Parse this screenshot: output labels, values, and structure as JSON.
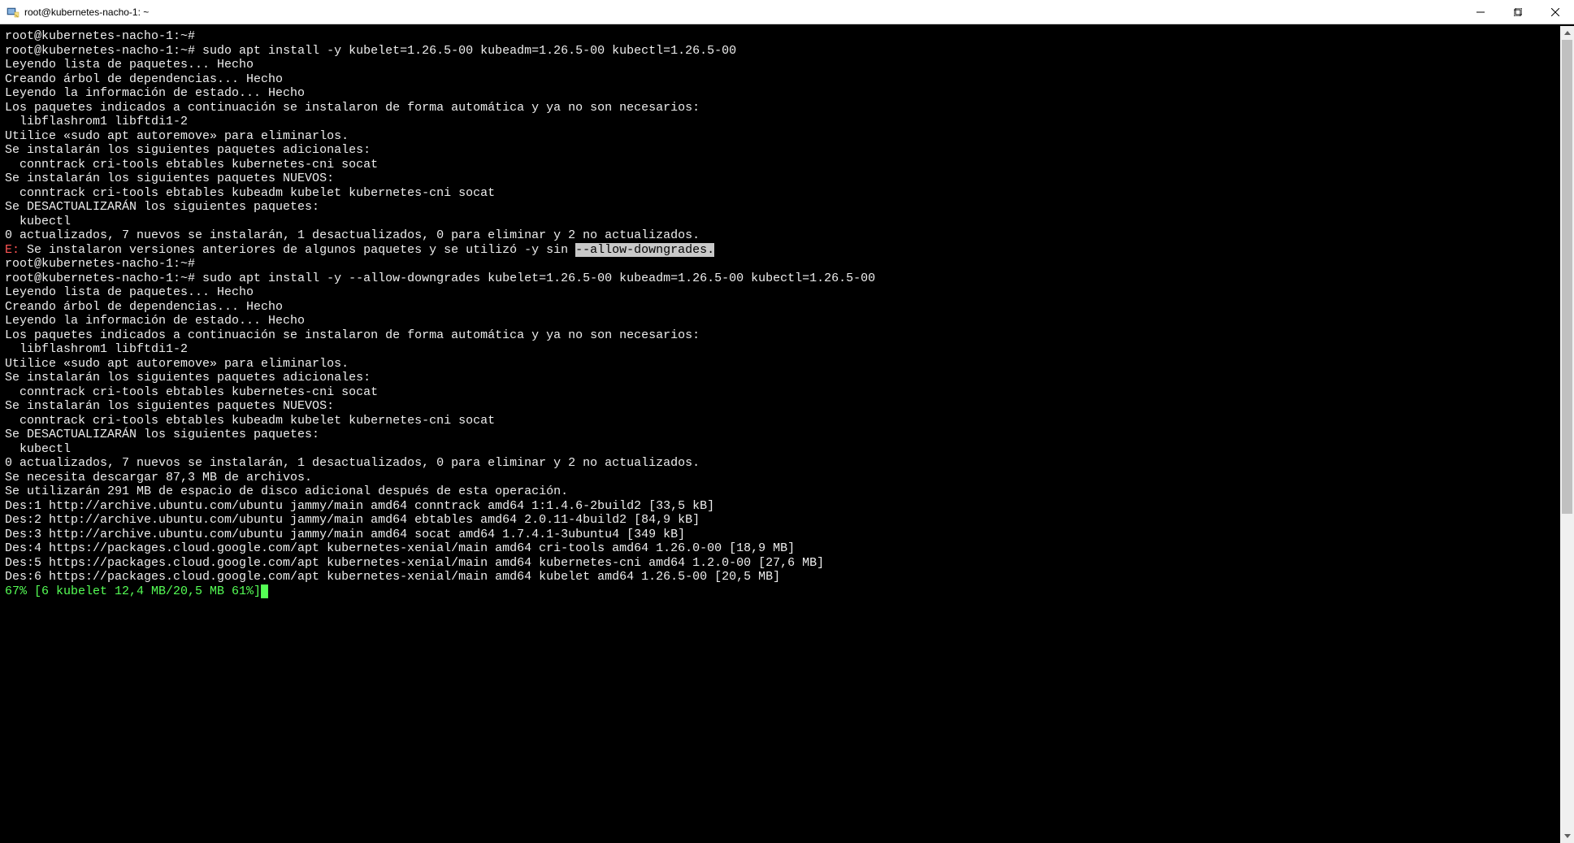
{
  "window": {
    "title": "root@kubernetes-nacho-1: ~"
  },
  "terminal": {
    "prompt1": "root@kubernetes-nacho-1:~#",
    "prompt1_cmd": "",
    "prompt2": "root@kubernetes-nacho-1:~#",
    "prompt2_cmd": " sudo apt install -y kubelet=1.26.5-00 kubeadm=1.26.5-00 kubectl=1.26.5-00",
    "b1_l1": "Leyendo lista de paquetes... Hecho",
    "b1_l2": "Creando árbol de dependencias... Hecho",
    "b1_l3": "Leyendo la información de estado... Hecho",
    "b1_l4": "Los paquetes indicados a continuación se instalaron de forma automática y ya no son necesarios:",
    "b1_l5": "  libflashrom1 libftdi1-2",
    "b1_l6": "Utilice «sudo apt autoremove» para eliminarlos.",
    "b1_l7": "Se instalarán los siguientes paquetes adicionales:",
    "b1_l8": "  conntrack cri-tools ebtables kubernetes-cni socat",
    "b1_l9": "Se instalarán los siguientes paquetes NUEVOS:",
    "b1_l10": "  conntrack cri-tools ebtables kubeadm kubelet kubernetes-cni socat",
    "b1_l11": "Se DESACTUALIZARÁN los siguientes paquetes:",
    "b1_l12": "  kubectl",
    "b1_l13": "0 actualizados, 7 nuevos se instalarán, 1 desactualizados, 0 para eliminar y 2 no actualizados.",
    "err_prefix": "E:",
    "err_text": " Se instalaron versiones anteriores de algunos paquetes y se utilizó -y sin ",
    "err_sel": "--allow-downgrades.",
    "prompt3": "root@kubernetes-nacho-1:~#",
    "prompt3_cmd": "",
    "prompt4": "root@kubernetes-nacho-1:~#",
    "prompt4_cmd": " sudo apt install -y --allow-downgrades kubelet=1.26.5-00 kubeadm=1.26.5-00 kubectl=1.26.5-00",
    "b2_l1": "Leyendo lista de paquetes... Hecho",
    "b2_l2": "Creando árbol de dependencias... Hecho",
    "b2_l3": "Leyendo la información de estado... Hecho",
    "b2_l4": "Los paquetes indicados a continuación se instalaron de forma automática y ya no son necesarios:",
    "b2_l5": "  libflashrom1 libftdi1-2",
    "b2_l6": "Utilice «sudo apt autoremove» para eliminarlos.",
    "b2_l7": "Se instalarán los siguientes paquetes adicionales:",
    "b2_l8": "  conntrack cri-tools ebtables kubernetes-cni socat",
    "b2_l9": "Se instalarán los siguientes paquetes NUEVOS:",
    "b2_l10": "  conntrack cri-tools ebtables kubeadm kubelet kubernetes-cni socat",
    "b2_l11": "Se DESACTUALIZARÁN los siguientes paquetes:",
    "b2_l12": "  kubectl",
    "b2_l13": "0 actualizados, 7 nuevos se instalarán, 1 desactualizados, 0 para eliminar y 2 no actualizados.",
    "b2_l14": "Se necesita descargar 87,3 MB de archivos.",
    "b2_l15": "Se utilizarán 291 MB de espacio de disco adicional después de esta operación.",
    "d1": "Des:1 http://archive.ubuntu.com/ubuntu jammy/main amd64 conntrack amd64 1:1.4.6-2build2 [33,5 kB]",
    "d2": "Des:2 http://archive.ubuntu.com/ubuntu jammy/main amd64 ebtables amd64 2.0.11-4build2 [84,9 kB]",
    "d3": "Des:3 http://archive.ubuntu.com/ubuntu jammy/main amd64 socat amd64 1.7.4.1-3ubuntu4 [349 kB]",
    "d4": "Des:4 https://packages.cloud.google.com/apt kubernetes-xenial/main amd64 cri-tools amd64 1.26.0-00 [18,9 MB]",
    "d5": "Des:5 https://packages.cloud.google.com/apt kubernetes-xenial/main amd64 kubernetes-cni amd64 1.2.0-00 [27,6 MB]",
    "d6": "Des:6 https://packages.cloud.google.com/apt kubernetes-xenial/main amd64 kubelet amd64 1.26.5-00 [20,5 MB]",
    "progress": "67% [6 kubelet 12,4 MB/20,5 MB 61%]"
  }
}
